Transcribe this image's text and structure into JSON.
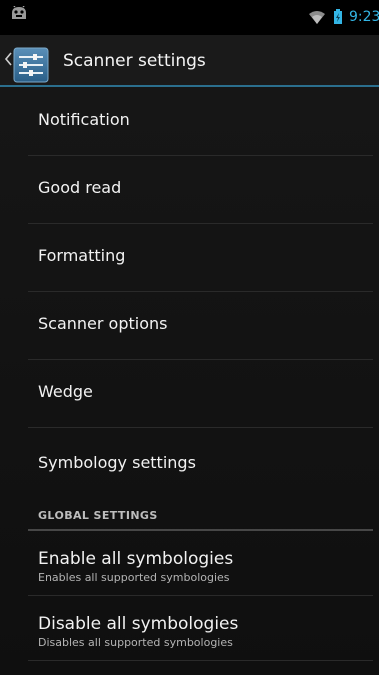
{
  "status_bar": {
    "time": "9:23",
    "icons": [
      "android-icon",
      "wifi-icon",
      "battery-icon"
    ]
  },
  "action_bar": {
    "title": "Scanner settings",
    "icons": [
      "up-caret-icon",
      "scanner-settings-app-icon"
    ],
    "accent_color": "#2b6f8e"
  },
  "preferences": {
    "items": [
      {
        "label": "Notification"
      },
      {
        "label": "Good read"
      },
      {
        "label": "Formatting"
      },
      {
        "label": "Scanner options"
      },
      {
        "label": "Wedge"
      },
      {
        "label": "Symbology settings"
      }
    ]
  },
  "global_settings": {
    "header": "GLOBAL SETTINGS",
    "items": [
      {
        "title": "Enable all symbologies",
        "summary": "Enables all supported symbologies"
      },
      {
        "title": "Disable all symbologies",
        "summary": "Disables all supported symbologies"
      }
    ]
  },
  "colors": {
    "background": "#141414",
    "status_bar": "#000000",
    "clock": "#33b5e5",
    "divider": "#2a2a2a"
  }
}
